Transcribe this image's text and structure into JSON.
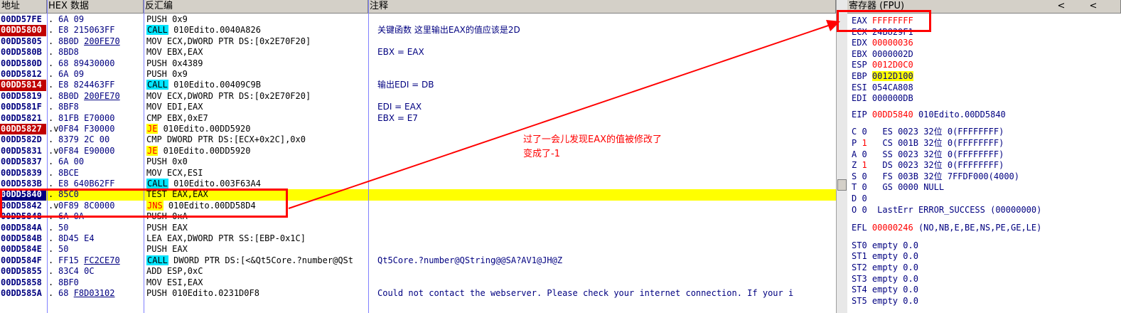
{
  "headers": {
    "addr": "地址",
    "hex": "HEX 数据",
    "asm": "反汇编",
    "comment": "注释",
    "regs": "寄存器 (FPU)",
    "nav_prev": "<",
    "nav_next": "<"
  },
  "rows": [
    {
      "addr": "00DD57FE",
      "mark": ".",
      "hex": "6A 09",
      "asm": "PUSH 0x9",
      "comment": ""
    },
    {
      "addr": "00DD5800",
      "mark": ".",
      "hex": "E8 215063FF",
      "kw": "CALL",
      "asm": " 010Edito.0040A826",
      "comment": "关键函数 这里输出EAX的值应该是2D"
    },
    {
      "addr": "00DD5805",
      "mark": ".",
      "hex": "8B0D ",
      "hexu": "200FE70",
      "asm": "MOV ECX,DWORD PTR DS:[0x2E70F20]",
      "comment": ""
    },
    {
      "addr": "00DD580B",
      "mark": ".",
      "hex": "8BD8",
      "asm": "MOV EBX,EAX",
      "comment": "EBX = EAX"
    },
    {
      "addr": "00DD580D",
      "mark": ".",
      "hex": "68 89430000",
      "asm": "PUSH 0x4389",
      "comment": ""
    },
    {
      "addr": "00DD5812",
      "mark": ".",
      "hex": "6A 09",
      "asm": "PUSH 0x9",
      "comment": ""
    },
    {
      "addr": "00DD5814",
      "mark": ".",
      "hex": "E8 824463FF",
      "kw": "CALL",
      "asm": " 010Edito.00409C9B",
      "comment": "输出EDI = DB"
    },
    {
      "addr": "00DD5819",
      "mark": ".",
      "hex": "8B0D ",
      "hexu": "200FE70",
      "asm": "MOV ECX,DWORD PTR DS:[0x2E70F20]",
      "comment": ""
    },
    {
      "addr": "00DD581F",
      "mark": ".",
      "hex": "8BF8",
      "asm": "MOV EDI,EAX",
      "comment": "EDI = EAX"
    },
    {
      "addr": "00DD5821",
      "mark": ".",
      "hex": "81FB E70000",
      "asm": "CMP EBX,0xE7",
      "comment": "EBX = E7"
    },
    {
      "addr": "00DD5827",
      "mark": ".v",
      "hex": "0F84 F30000",
      "kw": "JE",
      "asm": " 010Edito.00DD5920",
      "comment": ""
    },
    {
      "addr": "00DD582D",
      "mark": ".",
      "hex": "8379 2C 00",
      "asm": "CMP DWORD PTR DS:[ECX+0x2C],0x0",
      "comment": ""
    },
    {
      "addr": "00DD5831",
      "mark": ".v",
      "hex": "0F84 E90000",
      "kw": "JE",
      "asm": " 010Edito.00DD5920",
      "comment": ""
    },
    {
      "addr": "00DD5837",
      "mark": ".",
      "hex": "6A 00",
      "asm": "PUSH 0x0",
      "comment": ""
    },
    {
      "addr": "00DD5839",
      "mark": ".",
      "hex": "8BCE",
      "asm": "MOV ECX,ESI",
      "comment": ""
    },
    {
      "addr": "00DD583B",
      "mark": ".",
      "hex": "E8 640B62FF",
      "kw": "CALL",
      "asm": " 010Edito.003F63A4",
      "comment": ""
    },
    {
      "addr": "00DD5840",
      "mark": ".",
      "hex": "85C0",
      "asm": "TEST EAX,EAX",
      "comment": ""
    },
    {
      "addr": "00DD5842",
      "mark": ".v",
      "hex": "0F89 8C0000",
      "kw": "JNS",
      "asm": " 010Edito.00DD58D4",
      "comment": ""
    },
    {
      "addr": "00DD5848",
      "mark": ".",
      "hex": "6A 0A",
      "asm": "PUSH 0xA",
      "comment": ""
    },
    {
      "addr": "00DD584A",
      "mark": ".",
      "hex": "50",
      "asm": "PUSH EAX",
      "comment": ""
    },
    {
      "addr": "00DD584B",
      "mark": ".",
      "hex": "8D45 E4",
      "asm": "LEA EAX,DWORD PTR SS:[EBP-0x1C]",
      "comment": ""
    },
    {
      "addr": "00DD584E",
      "mark": ".",
      "hex": "50",
      "asm": "PUSH EAX",
      "comment": ""
    },
    {
      "addr": "00DD584F",
      "mark": ".",
      "hex": "FF15 ",
      "hexu": "FC2CE70",
      "kw": "CALL",
      "asm": " DWORD PTR DS:[<&Qt5Core.?number@QSt",
      "comment": "Qt5Core.?number@QString@@SA?AV1@JH@Z"
    },
    {
      "addr": "00DD5855",
      "mark": ".",
      "hex": "83C4 0C",
      "asm": "ADD ESP,0xC",
      "comment": ""
    },
    {
      "addr": "00DD5858",
      "mark": ".",
      "hex": "8BF0",
      "asm": "MOV ESI,EAX",
      "comment": ""
    },
    {
      "addr": "00DD585A",
      "mark": ".",
      "hex": "68 ",
      "hexu": "F8D03102",
      "asm": "PUSH 010Edito.0231D0F8",
      "comment": "Could not contact the webserver. Please check your internet connection. If your i"
    }
  ],
  "registers": {
    "general": [
      {
        "name": "EAX",
        "value": "FFFFFFFF",
        "red": true
      },
      {
        "name": "ECX",
        "value": "24B829F1",
        "red": false
      },
      {
        "name": "EDX",
        "value": "00000036",
        "red": true
      },
      {
        "name": "EBX",
        "value": "0000002D",
        "red": false
      },
      {
        "name": "ESP",
        "value": "0012D0C0",
        "red": true
      },
      {
        "name": "EBP",
        "value": "0012D100",
        "red": false
      },
      {
        "name": "ESI",
        "value": "054CA808",
        "red": false
      },
      {
        "name": "EDI",
        "value": "000000DB",
        "red": false
      }
    ],
    "eip": {
      "name": "EIP",
      "value": "00DD5840",
      "desc": "010Edito.00DD5840"
    },
    "flags": [
      {
        "f": "C",
        "v": "0",
        "seg": "ES 0023 32位 0(FFFFFFFF)",
        "red": false
      },
      {
        "f": "P",
        "v": "1",
        "seg": "CS 001B 32位 0(FFFFFFFF)",
        "red": true
      },
      {
        "f": "A",
        "v": "0",
        "seg": "SS 0023 32位 0(FFFFFFFF)",
        "red": false
      },
      {
        "f": "Z",
        "v": "1",
        "seg": "DS 0023 32位 0(FFFFFFFF)",
        "red": true
      },
      {
        "f": "S",
        "v": "0",
        "seg": "FS 003B 32位 7FFDF000(4000)",
        "red": false
      },
      {
        "f": "T",
        "v": "0",
        "seg": "GS 0000 NULL",
        "red": false
      },
      {
        "f": "D",
        "v": "0",
        "seg": "",
        "red": false
      },
      {
        "f": "O",
        "v": "0",
        "seg": "LastErr ERROR_SUCCESS (00000000)",
        "red": false
      }
    ],
    "efl": {
      "name": "EFL",
      "value": "00000246",
      "desc": "(NO,NB,E,BE,NS,PE,GE,LE)"
    },
    "fpu": [
      "ST0 empty 0.0",
      "ST1 empty 0.0",
      "ST2 empty 0.0",
      "ST3 empty 0.0",
      "ST4 empty 0.0",
      "ST5 empty 0.0"
    ]
  },
  "annotation": {
    "line1": "过了一会儿发现EAX的值被修改了",
    "line2": "变成了-1"
  },
  "colors": {
    "accent_red": "#ff0000",
    "highlight_yellow": "#ffff00",
    "call_cyan": "#00e5ff",
    "addr_blue": "#000080"
  }
}
